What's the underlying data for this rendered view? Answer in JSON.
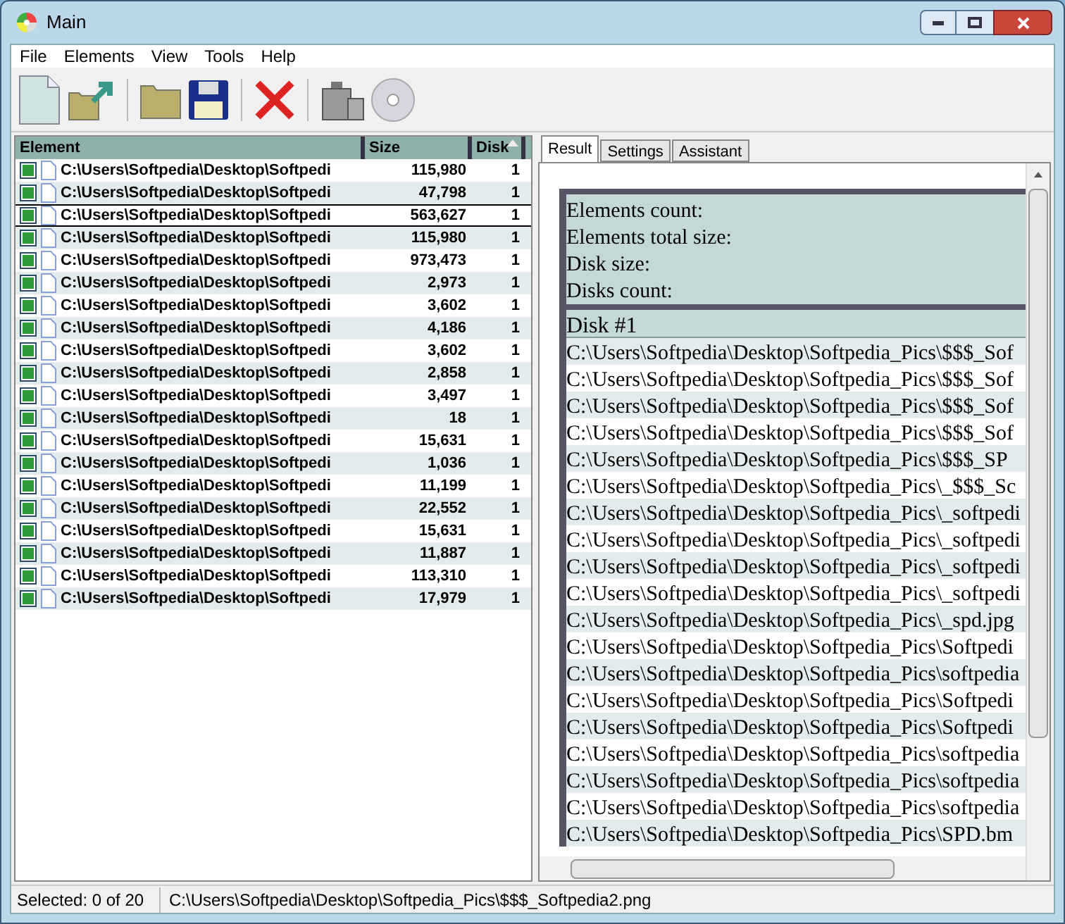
{
  "window": {
    "title": "Main"
  },
  "menu": [
    "File",
    "Elements",
    "View",
    "Tools",
    "Help"
  ],
  "list": {
    "columns": [
      {
        "label": "Element",
        "sorted": false
      },
      {
        "label": "Size",
        "sorted": false
      },
      {
        "label": "Disk",
        "sorted": true
      }
    ],
    "rows": [
      {
        "element": "C:\\Users\\Softpedia\\Desktop\\Softpedi",
        "size": "115,980",
        "disk": "1",
        "checked": true,
        "focused": false
      },
      {
        "element": "C:\\Users\\Softpedia\\Desktop\\Softpedi",
        "size": "47,798",
        "disk": "1",
        "checked": true,
        "focused": false
      },
      {
        "element": "C:\\Users\\Softpedia\\Desktop\\Softpedi",
        "size": "563,627",
        "disk": "1",
        "checked": true,
        "focused": true
      },
      {
        "element": "C:\\Users\\Softpedia\\Desktop\\Softpedi",
        "size": "115,980",
        "disk": "1",
        "checked": true,
        "focused": false
      },
      {
        "element": "C:\\Users\\Softpedia\\Desktop\\Softpedi",
        "size": "973,473",
        "disk": "1",
        "checked": true,
        "focused": false
      },
      {
        "element": "C:\\Users\\Softpedia\\Desktop\\Softpedi",
        "size": "2,973",
        "disk": "1",
        "checked": true,
        "focused": false
      },
      {
        "element": "C:\\Users\\Softpedia\\Desktop\\Softpedi",
        "size": "3,602",
        "disk": "1",
        "checked": true,
        "focused": false
      },
      {
        "element": "C:\\Users\\Softpedia\\Desktop\\Softpedi",
        "size": "4,186",
        "disk": "1",
        "checked": true,
        "focused": false
      },
      {
        "element": "C:\\Users\\Softpedia\\Desktop\\Softpedi",
        "size": "3,602",
        "disk": "1",
        "checked": true,
        "focused": false
      },
      {
        "element": "C:\\Users\\Softpedia\\Desktop\\Softpedi",
        "size": "2,858",
        "disk": "1",
        "checked": true,
        "focused": false
      },
      {
        "element": "C:\\Users\\Softpedia\\Desktop\\Softpedi",
        "size": "3,497",
        "disk": "1",
        "checked": true,
        "focused": false
      },
      {
        "element": "C:\\Users\\Softpedia\\Desktop\\Softpedi",
        "size": "18",
        "disk": "1",
        "checked": true,
        "focused": false
      },
      {
        "element": "C:\\Users\\Softpedia\\Desktop\\Softpedi",
        "size": "15,631",
        "disk": "1",
        "checked": true,
        "focused": false
      },
      {
        "element": "C:\\Users\\Softpedia\\Desktop\\Softpedi",
        "size": "1,036",
        "disk": "1",
        "checked": true,
        "focused": false
      },
      {
        "element": "C:\\Users\\Softpedia\\Desktop\\Softpedi",
        "size": "11,199",
        "disk": "1",
        "checked": true,
        "focused": false
      },
      {
        "element": "C:\\Users\\Softpedia\\Desktop\\Softpedi",
        "size": "22,552",
        "disk": "1",
        "checked": true,
        "focused": false
      },
      {
        "element": "C:\\Users\\Softpedia\\Desktop\\Softpedi",
        "size": "15,631",
        "disk": "1",
        "checked": true,
        "focused": false
      },
      {
        "element": "C:\\Users\\Softpedia\\Desktop\\Softpedi",
        "size": "11,887",
        "disk": "1",
        "checked": true,
        "focused": false
      },
      {
        "element": "C:\\Users\\Softpedia\\Desktop\\Softpedi",
        "size": "113,310",
        "disk": "1",
        "checked": true,
        "focused": false
      },
      {
        "element": "C:\\Users\\Softpedia\\Desktop\\Softpedi",
        "size": "17,979",
        "disk": "1",
        "checked": true,
        "focused": false
      }
    ]
  },
  "tabs": [
    {
      "label": "Result",
      "selected": true
    },
    {
      "label": "Settings",
      "selected": false
    },
    {
      "label": "Assistant",
      "selected": false
    }
  ],
  "result": {
    "summary": [
      "Elements count:",
      "Elements total size:",
      "Disk size:",
      "Disks count:"
    ],
    "disk_header": "Disk #1",
    "files": [
      "C:\\Users\\Softpedia\\Desktop\\Softpedia_Pics\\$$$_Sof",
      "C:\\Users\\Softpedia\\Desktop\\Softpedia_Pics\\$$$_Sof",
      "C:\\Users\\Softpedia\\Desktop\\Softpedia_Pics\\$$$_Sof",
      "C:\\Users\\Softpedia\\Desktop\\Softpedia_Pics\\$$$_Sof",
      "C:\\Users\\Softpedia\\Desktop\\Softpedia_Pics\\$$$_SP",
      "C:\\Users\\Softpedia\\Desktop\\Softpedia_Pics\\_$$$_Sc",
      "C:\\Users\\Softpedia\\Desktop\\Softpedia_Pics\\_softpedi",
      "C:\\Users\\Softpedia\\Desktop\\Softpedia_Pics\\_softpedi",
      "C:\\Users\\Softpedia\\Desktop\\Softpedia_Pics\\_softpedi",
      "C:\\Users\\Softpedia\\Desktop\\Softpedia_Pics\\_softpedi",
      "C:\\Users\\Softpedia\\Desktop\\Softpedia_Pics\\_spd.jpg",
      "C:\\Users\\Softpedia\\Desktop\\Softpedia_Pics\\Softpedi",
      "C:\\Users\\Softpedia\\Desktop\\Softpedia_Pics\\softpedia",
      "C:\\Users\\Softpedia\\Desktop\\Softpedia_Pics\\Softpedi",
      "C:\\Users\\Softpedia\\Desktop\\Softpedia_Pics\\Softpedi",
      "C:\\Users\\Softpedia\\Desktop\\Softpedia_Pics\\softpedia",
      "C:\\Users\\Softpedia\\Desktop\\Softpedia_Pics\\softpedia",
      "C:\\Users\\Softpedia\\Desktop\\Softpedia_Pics\\softpedia",
      "C:\\Users\\Softpedia\\Desktop\\Softpedia_Pics\\SPD.bm"
    ]
  },
  "status_bar": {
    "selection": "Selected: 0 of 20",
    "path": "C:\\Users\\Softpedia\\Desktop\\Softpedia_Pics\\$$$_Softpedia2.png"
  }
}
